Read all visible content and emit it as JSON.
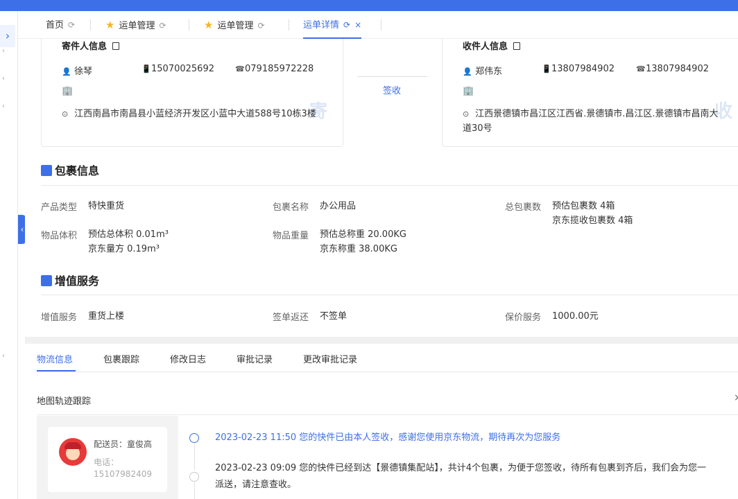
{
  "tabs": [
    {
      "label": "首页"
    },
    {
      "label": "运单管理"
    },
    {
      "label": "运单管理"
    },
    {
      "label": "运单详情"
    }
  ],
  "sender": {
    "title": "寄件人信息",
    "name": "徐琴",
    "mobile": "15070025692",
    "phone": "079185972228",
    "address": "江西南昌市南昌县小蓝经济开发区小蓝中大道588号10栋3楼",
    "watermark": "寄"
  },
  "receiver": {
    "title": "收件人信息",
    "name": "郑伟东",
    "mobile": "13807984902",
    "phone": "13807984902",
    "address": "江西景德镇市昌江区江西省.景德镇市.昌江区.景德镇市昌南大道30号",
    "watermark": "收"
  },
  "sign_status": "签收",
  "package": {
    "title": "包裹信息",
    "product_type_label": "产品类型",
    "product_type": "特快重货",
    "package_name_label": "包裹名称",
    "package_name": "办公用品",
    "total_label": "总包裹数",
    "total_est": "预估包裹数 4箱",
    "total_jd": "京东揽收包裹数 4箱",
    "volume_label": "物品体积",
    "volume_est": "预估总体积 0.01m³",
    "volume_jd": "京东量方 0.19m³",
    "weight_label": "物品重量",
    "weight_est": "预估总称重 20.00KG",
    "weight_jd": "京东称重 38.00KG"
  },
  "value_added": {
    "title": "增值服务",
    "service_label": "增值服务",
    "service": "重货上楼",
    "return_label": "签单返还",
    "return": "不签单",
    "insure_label": "保价服务",
    "insure": "1000.00元"
  },
  "bottom_tabs": [
    "物流信息",
    "包裹跟踪",
    "修改日志",
    "审批记录",
    "更改审批记录"
  ],
  "map_title": "地图轨迹跟踪",
  "courier": {
    "name": "配送员：童俊高",
    "phone_label": "电话：",
    "phone": "15107982409"
  },
  "timeline": [
    {
      "text": "2023-02-23 11:50 您的快件已由本人签收，感谢您使用京东物流，期待再次为您服务"
    },
    {
      "text": "2023-02-23 09:09 您的快件已经到达【景德镇集配站】，共计4个包裹，为便于您签收，待所有包裹到齐后，我们会为您一",
      "text2": "派送，请注意查收。"
    }
  ]
}
